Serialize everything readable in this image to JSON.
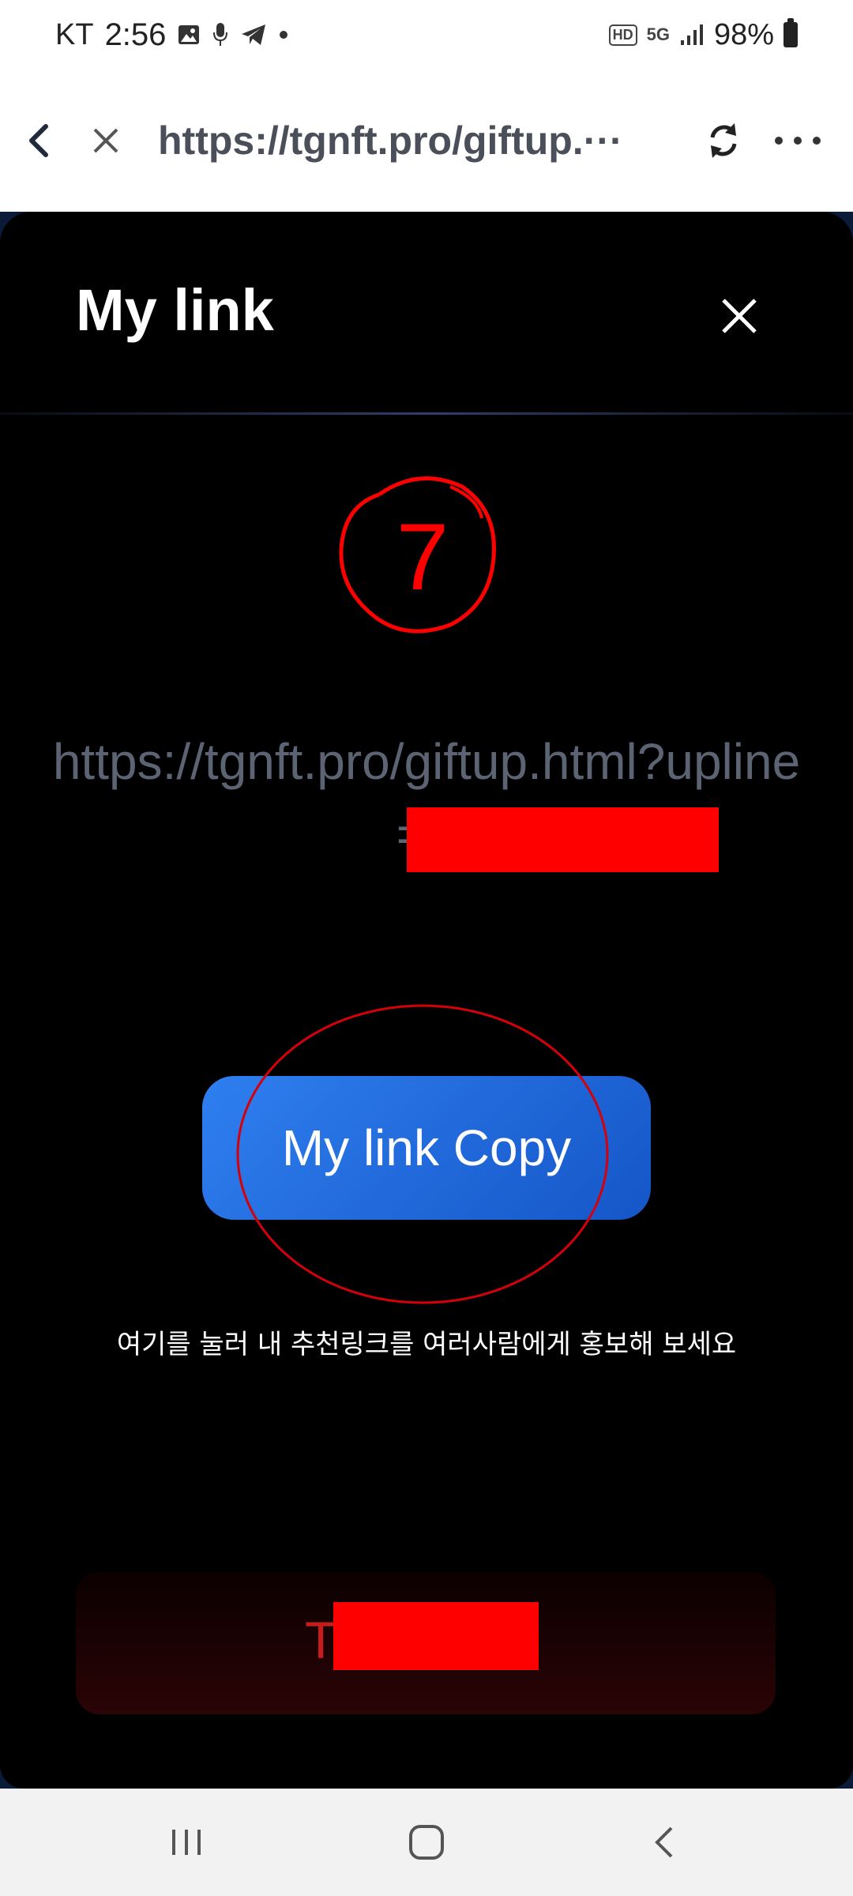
{
  "status_bar": {
    "carrier": "KT",
    "time": "2:56",
    "left_icons": [
      "gallery-icon",
      "mic-icon",
      "telegram-icon",
      "dot-icon"
    ],
    "hd_badge": "HD",
    "network": "5G",
    "battery": "98%"
  },
  "browser": {
    "url": "https://tgnft.pro/giftup.···"
  },
  "modal": {
    "title": "My link",
    "annotation_number": "7",
    "link_text": "https://tgnft.pro/giftup.html?upline=T",
    "copy_button": "My link Copy",
    "hint": "여기를 눌러 내 추천링크를 여러사람에게 홍보해 보세요",
    "bottom_text": "T                0"
  },
  "colors": {
    "accent_blue": "#2f7ff0",
    "annotation_red": "#ff0000",
    "modal_bg": "#000000"
  }
}
